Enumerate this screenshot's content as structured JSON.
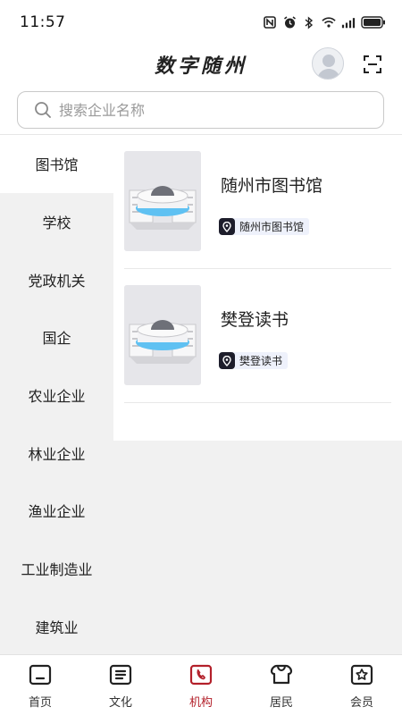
{
  "status_bar": {
    "time": "11:57",
    "icons": [
      "nfc-icon",
      "alarm-icon",
      "bluetooth-icon",
      "wifi-icon",
      "signal-icon",
      "battery-icon"
    ]
  },
  "header": {
    "title": "数字随州",
    "avatar_icon": "avatar-icon",
    "scan_icon": "scan-icon"
  },
  "search": {
    "placeholder": "搜索企业名称",
    "icon": "search-icon"
  },
  "categories": [
    {
      "label": "图书馆",
      "active": true
    },
    {
      "label": "学校",
      "active": false
    },
    {
      "label": "党政机关",
      "active": false
    },
    {
      "label": "国企",
      "active": false
    },
    {
      "label": "农业企业",
      "active": false
    },
    {
      "label": "林业企业",
      "active": false
    },
    {
      "label": "渔业企业",
      "active": false
    },
    {
      "label": "工业制造业",
      "active": false
    },
    {
      "label": "建筑业",
      "active": false
    }
  ],
  "institutions": [
    {
      "name": "随州市图书馆",
      "tag": "随州市图书馆",
      "tag_icon": "location-pin-icon"
    },
    {
      "name": "樊登读书",
      "tag": "樊登读书",
      "tag_icon": "location-pin-icon"
    }
  ],
  "tabbar": {
    "tabs": [
      {
        "label": "首页",
        "icon": "home-icon",
        "active": false
      },
      {
        "label": "文化",
        "icon": "culture-icon",
        "active": false
      },
      {
        "label": "机构",
        "icon": "institution-icon",
        "active": true
      },
      {
        "label": "居民",
        "icon": "residents-icon",
        "active": false
      },
      {
        "label": "会员",
        "icon": "member-icon",
        "active": false
      }
    ]
  },
  "colors": {
    "accent": "#b3202a",
    "page_bg": "#f1f1f1",
    "tag_bg": "#eef1fb"
  }
}
